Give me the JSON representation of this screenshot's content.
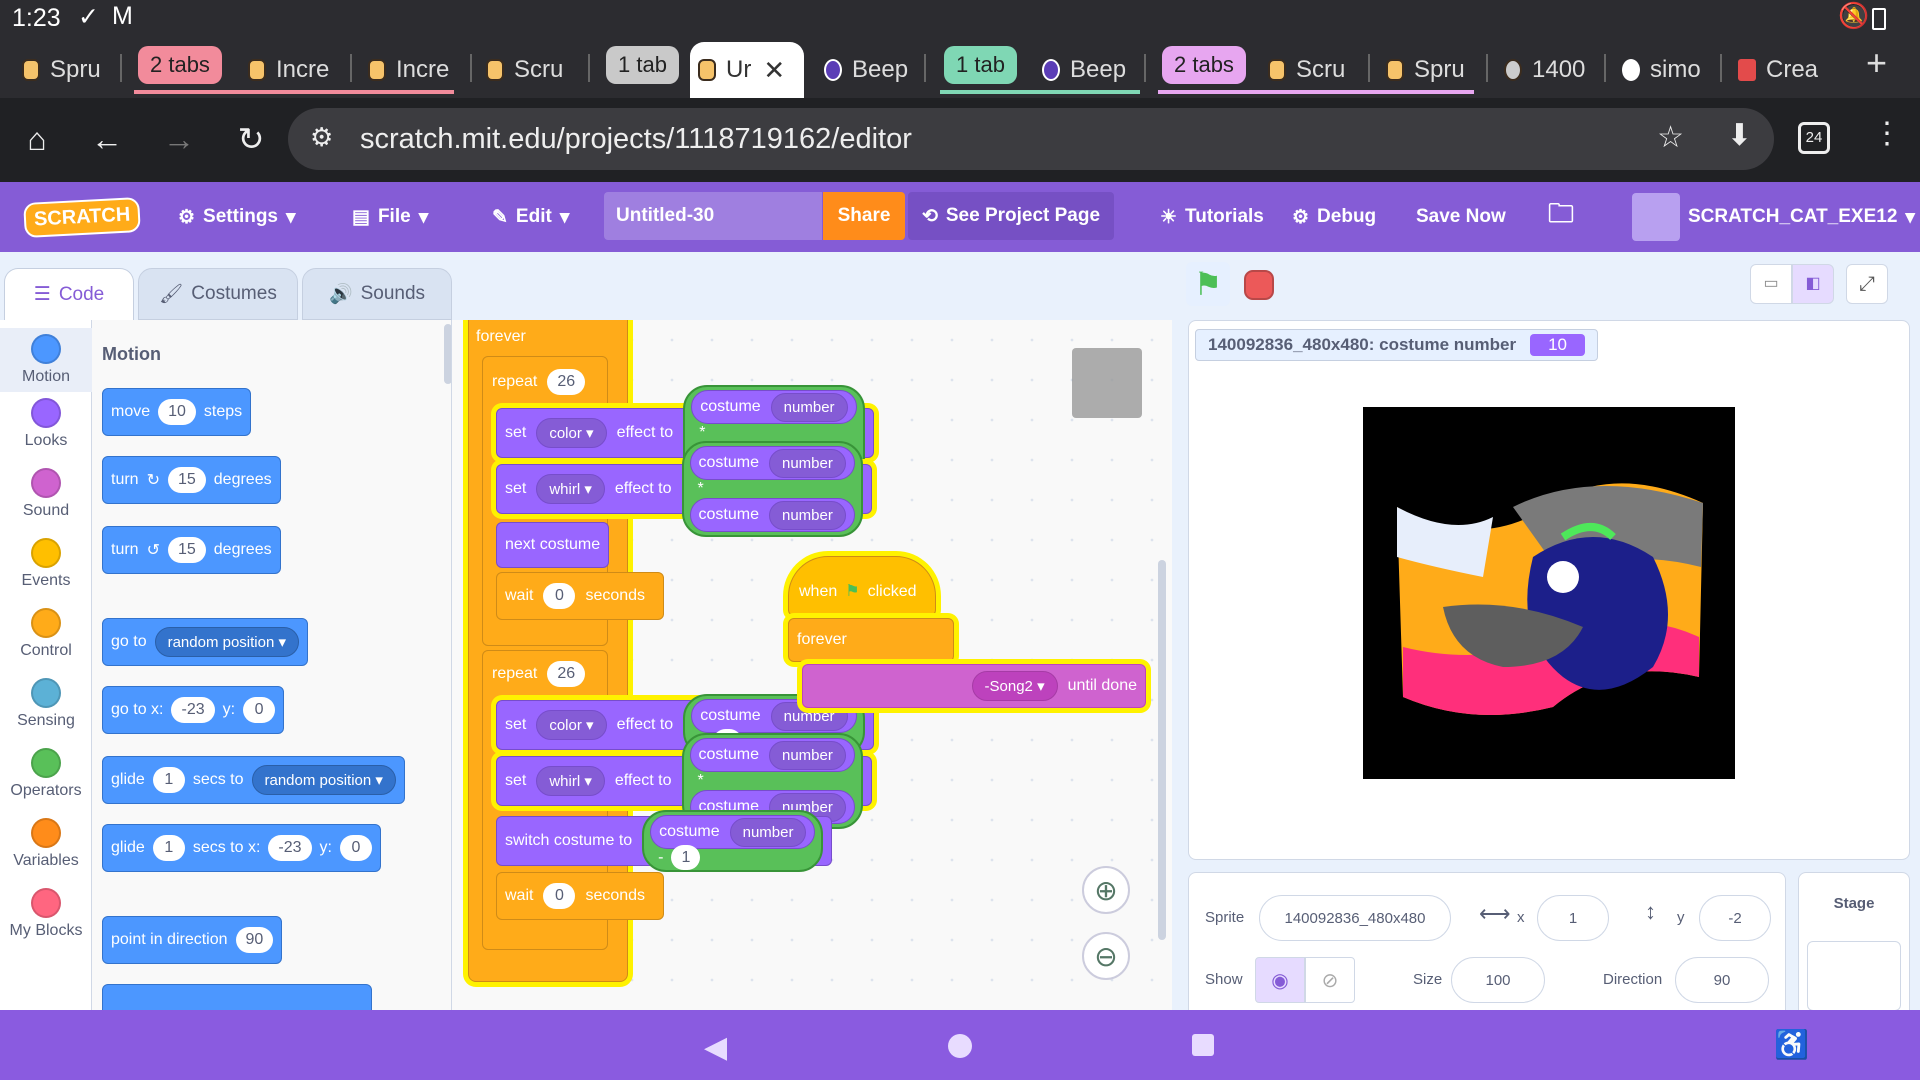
{
  "status": {
    "time": "1:23"
  },
  "tabs": [
    {
      "label": "Spru"
    },
    {
      "group": "2 tabs",
      "color": "#f28b9b"
    },
    {
      "label": "Incre"
    },
    {
      "label": "Incre"
    },
    {
      "label": "Scru"
    },
    {
      "group": "1 tab",
      "color": "#c9c9c9"
    },
    {
      "label": "Ur",
      "active": true
    },
    {
      "label": "Beep"
    },
    {
      "group": "1 tab",
      "color": "#7fd7b4"
    },
    {
      "label": "Beep"
    },
    {
      "group": "2 tabs",
      "color": "#e7a6f0"
    },
    {
      "label": "Scru"
    },
    {
      "label": "Spru"
    },
    {
      "label": "1400"
    },
    {
      "label": "simo"
    },
    {
      "label": "Crea"
    }
  ],
  "browser": {
    "url": "scratch.mit.edu/projects/1118719162/editor",
    "tab_count": "24"
  },
  "menubar": {
    "logo": "SCRATCH",
    "settings": "Settings",
    "file": "File",
    "edit": "Edit",
    "title": "Untitled-30",
    "share": "Share",
    "see_project": "See Project Page",
    "tutorials": "Tutorials",
    "debug": "Debug",
    "save_now": "Save Now",
    "username": "SCRATCH_CAT_EXE12"
  },
  "editor_tabs": {
    "code": "Code",
    "costumes": "Costumes",
    "sounds": "Sounds"
  },
  "categories": [
    {
      "label": "Motion",
      "color": "#4c97ff"
    },
    {
      "label": "Looks",
      "color": "#9966ff"
    },
    {
      "label": "Sound",
      "color": "#cf63cf"
    },
    {
      "label": "Events",
      "color": "#ffbf00"
    },
    {
      "label": "Control",
      "color": "#ffab19"
    },
    {
      "label": "Sensing",
      "color": "#5cb1d6"
    },
    {
      "label": "Operators",
      "color": "#59c059"
    },
    {
      "label": "Variables",
      "color": "#ff8c1a"
    },
    {
      "label": "My Blocks",
      "color": "#ff6680"
    }
  ],
  "palette": {
    "heading": "Motion",
    "move": {
      "a": "move",
      "v": "10",
      "b": "steps"
    },
    "turn_right": {
      "a": "turn",
      "v": "15",
      "b": "degrees"
    },
    "turn_left": {
      "a": "turn",
      "v": "15",
      "b": "degrees"
    },
    "goto": {
      "a": "go to",
      "d": "random position"
    },
    "gotoxy": {
      "a": "go to x:",
      "x": "-23",
      "yl": "y:",
      "y": "0"
    },
    "glide": {
      "a": "glide",
      "v": "1",
      "b": "secs to",
      "d": "random position"
    },
    "glidexy": {
      "a": "glide",
      "v": "1",
      "b": "secs to x:",
      "x": "-23",
      "yl": "y:",
      "y": "0"
    },
    "point": {
      "a": "point in direction",
      "v": "90"
    }
  },
  "script": {
    "forever": "forever",
    "repeat1": {
      "label": "repeat",
      "v": "26"
    },
    "set_color": {
      "set": "set",
      "opt": "color",
      "eff": "effect to",
      "c1": "costume",
      "n1": "number",
      "op": "*",
      "c2": "costume",
      "n2": "number"
    },
    "set_whirl": {
      "set": "set",
      "opt": "whirl",
      "eff": "effect to",
      "c1": "costume",
      "n1": "number",
      "op": "*",
      "c2": "costume",
      "n2": "number"
    },
    "next_costume": "next costume",
    "wait1": {
      "a": "wait",
      "v": "0",
      "b": "seconds"
    },
    "repeat2": {
      "label": "repeat",
      "v": "26"
    },
    "set_color2": {
      "set": "set",
      "opt": "color",
      "eff": "effect to",
      "c1": "costume",
      "n1": "number",
      "op": "*",
      "v": "1"
    },
    "set_whirl2": {
      "set": "set",
      "opt": "whirl",
      "eff": "effect to",
      "c1": "costume",
      "n1": "number",
      "op": "*",
      "c2": "costume",
      "n2": "number"
    },
    "switch": {
      "a": "switch costume to",
      "c1": "costume",
      "n1": "number",
      "op": "-",
      "v": "1"
    },
    "wait2": {
      "a": "wait",
      "v": "0",
      "b": "seconds"
    },
    "hat": {
      "when": "when",
      "clicked": "clicked",
      "forever": "forever",
      "sound": "-Song2",
      "until": "until done"
    }
  },
  "stage": {
    "monitor_label": "140092836_480x480: costume number",
    "monitor_value": "10"
  },
  "sprite": {
    "label": "Sprite",
    "name": "140092836_480x480",
    "x_label": "x",
    "x": "1",
    "y_label": "y",
    "y": "-2",
    "show": "Show",
    "size_label": "Size",
    "size": "100",
    "dir_label": "Direction",
    "direction": "90"
  },
  "stage_panel": {
    "label": "Stage"
  }
}
